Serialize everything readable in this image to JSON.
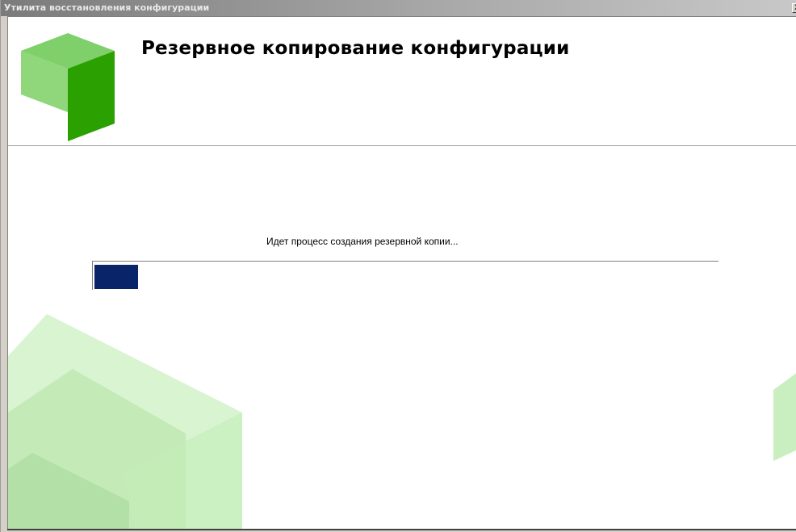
{
  "window": {
    "title": "Утилита восстановления конфигурации",
    "close_label": "X"
  },
  "header": {
    "title": "Резервное копирование конфигурации",
    "logo_icon": "green-cube-logo-icon"
  },
  "main": {
    "status_text": "Идет процесс создания резервной копии...",
    "progress_fraction": 0.07
  },
  "colors": {
    "logo_dark_green": "#2aa100",
    "logo_light_green": "#8fd77a",
    "progress_fill": "#0a246a",
    "background_art": "#c9efc0"
  }
}
